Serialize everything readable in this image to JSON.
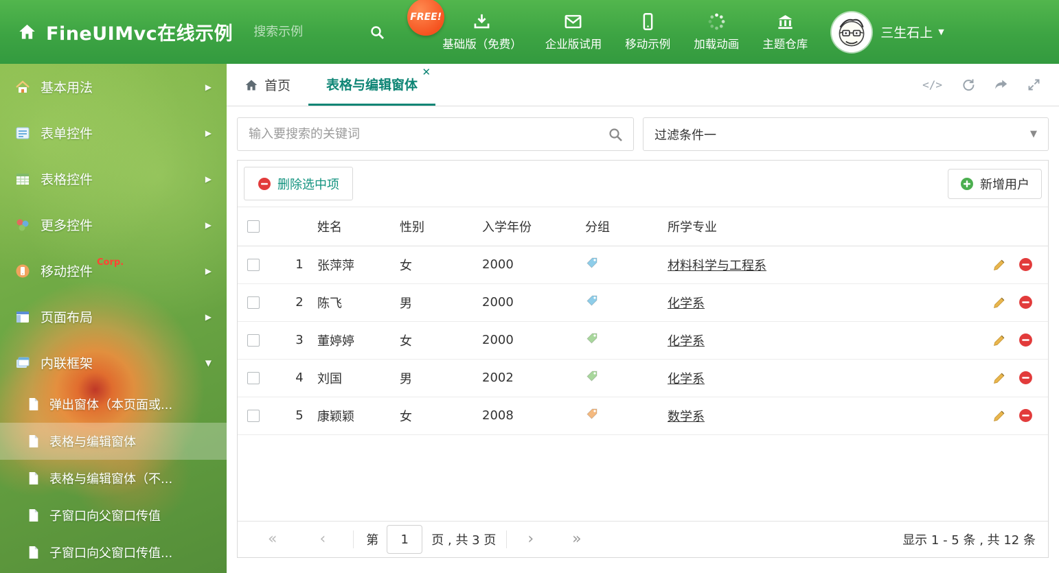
{
  "colors": {
    "header_green": "#3da443",
    "accent_teal": "#0e8575",
    "free_badge_orange": "#f4511e",
    "delete_red": "#e23b3b",
    "add_green": "#4caf50",
    "corp_red": "#ff4434"
  },
  "header": {
    "title": "FineUIMvc在线示例",
    "search_placeholder": "搜索示例",
    "free_badge": "FREE!",
    "nav_items": [
      {
        "label": "基础版（免费）",
        "icon": "download-icon"
      },
      {
        "label": "企业版试用",
        "icon": "envelope-icon"
      },
      {
        "label": "移动示例",
        "icon": "mobile-icon"
      },
      {
        "label": "加载动画",
        "icon": "spinner-icon"
      },
      {
        "label": "主题仓库",
        "icon": "bank-icon"
      }
    ],
    "user_name": "三生石上"
  },
  "sidebar": {
    "items": [
      {
        "label": "基本用法",
        "icon": "home-icon"
      },
      {
        "label": "表单控件",
        "icon": "form-icon"
      },
      {
        "label": "表格控件",
        "icon": "table-icon"
      },
      {
        "label": "更多控件",
        "icon": "widgets-icon"
      },
      {
        "label": "移动控件",
        "badge": "Corp.",
        "icon": "mobile-icon"
      },
      {
        "label": "页面布局",
        "icon": "layout-icon"
      },
      {
        "label": "内联框架",
        "icon": "frame-icon"
      }
    ],
    "subitems": [
      {
        "label": "弹出窗体（本页面或..."
      },
      {
        "label": "表格与编辑窗体",
        "active": true
      },
      {
        "label": "表格与编辑窗体（不..."
      },
      {
        "label": "子窗口向父窗口传值"
      },
      {
        "label": "子窗口向父窗口传值..."
      }
    ]
  },
  "tabs": {
    "home": "首页",
    "active": "表格与编辑窗体"
  },
  "filters": {
    "search_placeholder": "输入要搜索的关键词",
    "filter_value": "过滤条件一"
  },
  "toolbar": {
    "delete_label": "删除选中项",
    "add_label": "新增用户"
  },
  "table": {
    "columns": [
      "姓名",
      "性别",
      "入学年份",
      "分组",
      "所学专业"
    ],
    "rows": [
      {
        "index": "1",
        "name": "张萍萍",
        "gender": "女",
        "year": "2000",
        "tag_color": "#8ecde9",
        "major": "材料科学与工程系"
      },
      {
        "index": "2",
        "name": "陈飞",
        "gender": "男",
        "year": "2000",
        "tag_color": "#8ecde9",
        "major": "化学系"
      },
      {
        "index": "3",
        "name": "董婷婷",
        "gender": "女",
        "year": "2000",
        "tag_color": "#a8d79c",
        "major": "化学系"
      },
      {
        "index": "4",
        "name": "刘国",
        "gender": "男",
        "year": "2002",
        "tag_color": "#a8d79c",
        "major": "化学系"
      },
      {
        "index": "5",
        "name": "康颖颖",
        "gender": "女",
        "year": "2008",
        "tag_color": "#f4b97f",
        "major": "数学系"
      }
    ]
  },
  "pagination": {
    "prefix": "第",
    "current_page": "1",
    "suffix": "页 , 共 3 页",
    "summary": "显示 1 - 5 条 , 共 12 条"
  }
}
